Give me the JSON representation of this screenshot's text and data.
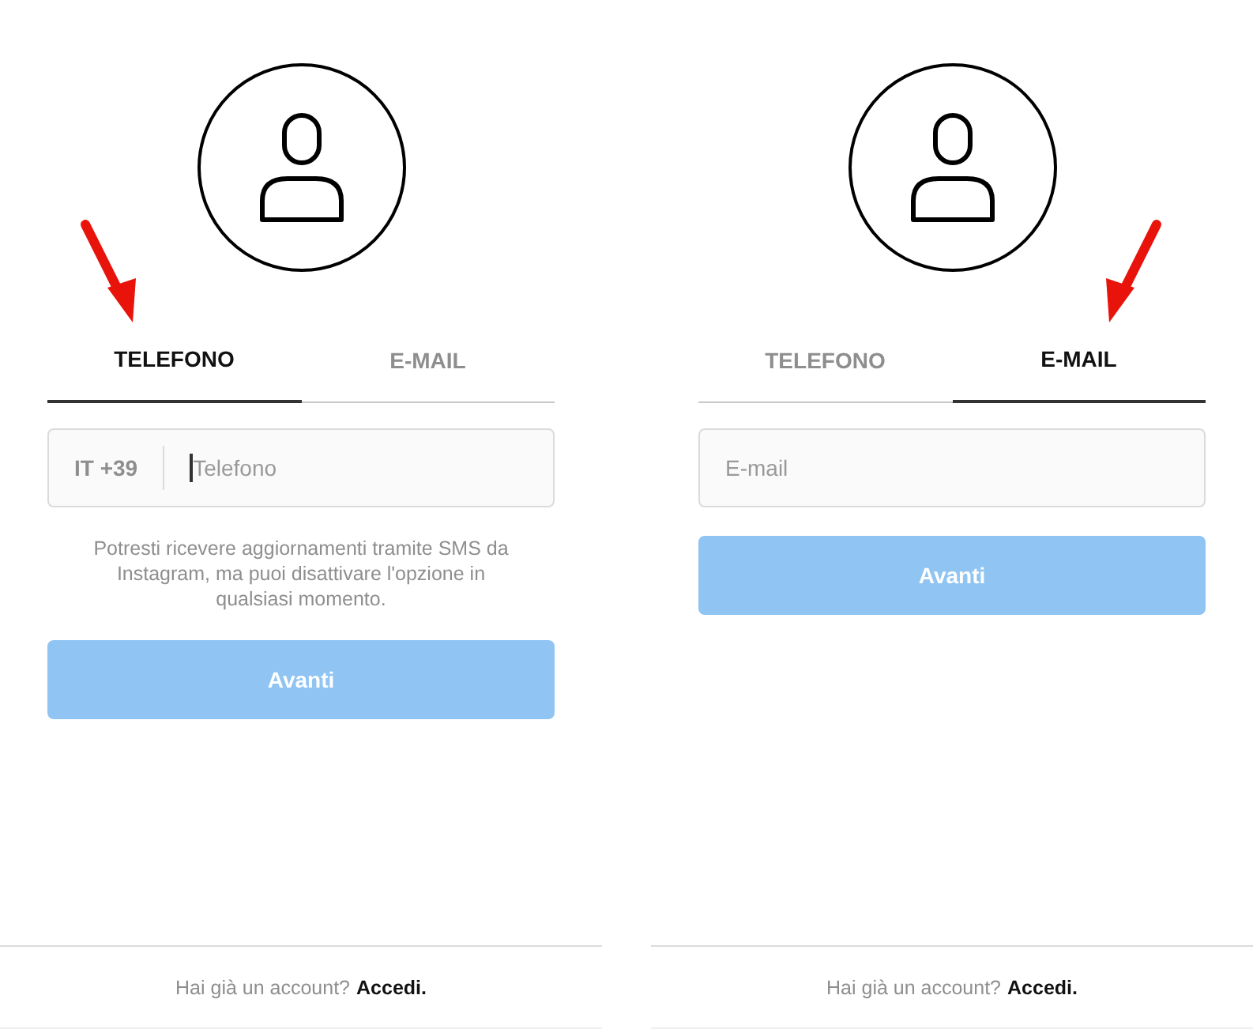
{
  "panels": [
    {
      "tabs": [
        {
          "label": "TELEFONO",
          "selected": true,
          "arrow": true
        },
        {
          "label": "E-MAIL",
          "selected": false,
          "arrow": false
        }
      ],
      "field": {
        "kind": "phone",
        "prefix": "IT +39",
        "placeholder": "Telefono",
        "focused": true
      },
      "note": "Potresti ricevere aggiornamenti tramite SMS da Instagram, ma puoi disattivare l'opzione in qualsiasi momento.",
      "button": {
        "label": "Avanti",
        "disabled": true
      },
      "footer": {
        "text": "Hai già un account?",
        "link": "Accedi."
      }
    },
    {
      "tabs": [
        {
          "label": "TELEFONO",
          "selected": false,
          "arrow": false
        },
        {
          "label": "E-MAIL",
          "selected": true,
          "arrow": true
        }
      ],
      "field": {
        "kind": "email",
        "placeholder": "E-mail",
        "focused": false
      },
      "button": {
        "label": "Avanti",
        "disabled": true
      },
      "footer": {
        "text": "Hai già un account?",
        "link": "Accedi."
      }
    }
  ]
}
